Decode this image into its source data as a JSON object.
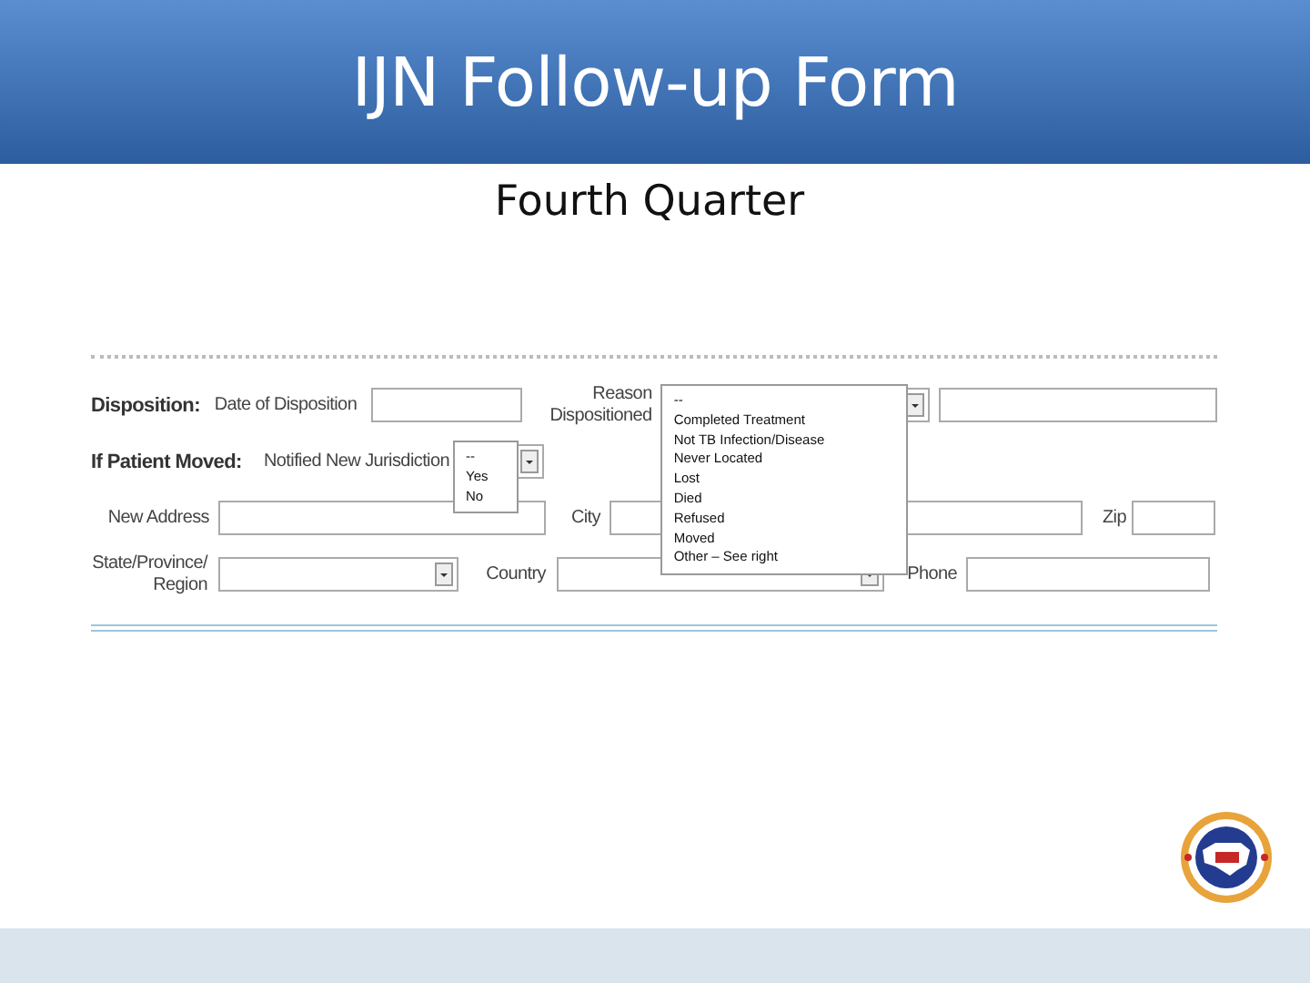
{
  "slide": {
    "title": "IJN Follow-up Form",
    "subtitle": "Fourth Quarter"
  },
  "form": {
    "disposition": {
      "heading": "Disposition:",
      "date_label": "Date of Disposition",
      "reason_label": "Reason Dispositioned",
      "reason_expanded": true,
      "reason_options": [
        "--",
        "Completed Treatment",
        "Not TB Infection/Disease",
        "Never Located",
        "Lost",
        "Died",
        "Refused",
        "Moved",
        "Other – See right"
      ]
    },
    "moved": {
      "heading": "If Patient Moved:",
      "notified_label": "Notified New Jurisdiction",
      "notified_expanded": true,
      "notified_options": [
        "--",
        "Yes",
        "No"
      ]
    },
    "address": {
      "address_label": "New Address",
      "city_label": "City",
      "zip_label": "Zip"
    },
    "region": {
      "state_label": "State/Province/ Region",
      "country_label": "Country",
      "phone_label": "Phone"
    }
  }
}
